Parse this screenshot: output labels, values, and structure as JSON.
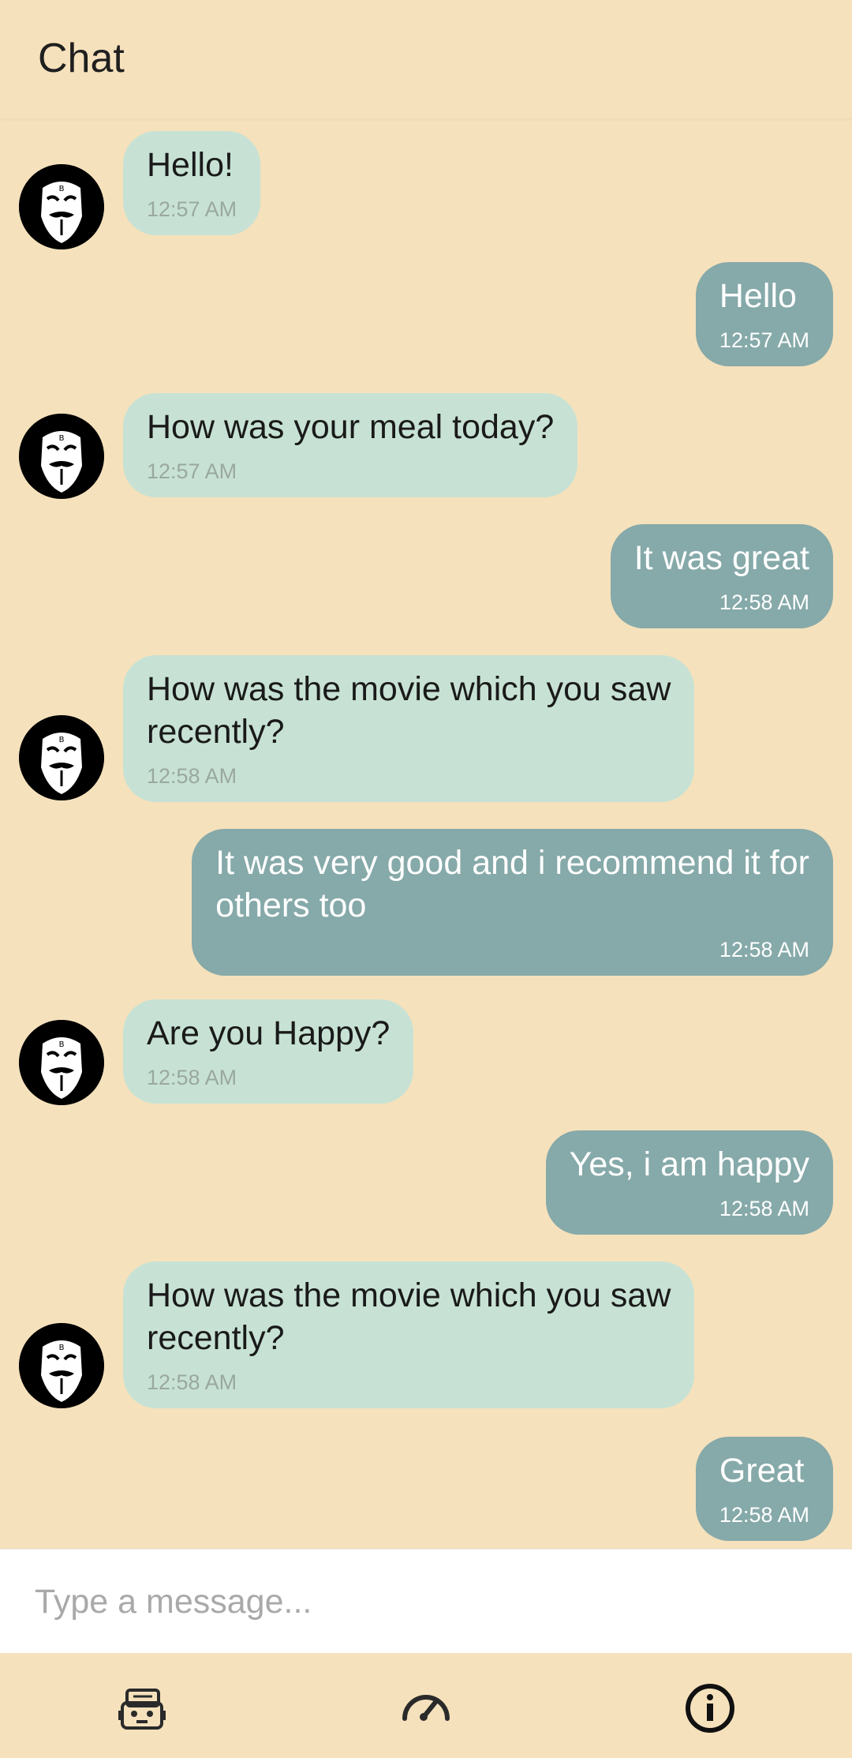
{
  "header": {
    "title": "Chat"
  },
  "messages": [
    {
      "sender": "bot",
      "text": "Hello!",
      "time": "12:57 AM"
    },
    {
      "sender": "user",
      "text": "Hello",
      "time": "12:57 AM"
    },
    {
      "sender": "bot",
      "text": "How was your meal today?",
      "time": "12:57 AM"
    },
    {
      "sender": "user",
      "text": "It was great",
      "time": "12:58 AM"
    },
    {
      "sender": "bot",
      "text": "How was the movie which you saw\nrecently?",
      "time": "12:58 AM"
    },
    {
      "sender": "user",
      "text": "It was very good and i recommend it for\nothers too",
      "time": "12:58 AM"
    },
    {
      "sender": "bot",
      "text": "Are you Happy?",
      "time": "12:58 AM"
    },
    {
      "sender": "user",
      "text": "Yes, i am happy",
      "time": "12:58 AM"
    },
    {
      "sender": "bot",
      "text": "How was the movie which you saw\nrecently?",
      "time": "12:58 AM"
    },
    {
      "sender": "user",
      "text": "Great",
      "time": "12:58 AM"
    }
  ],
  "composer": {
    "placeholder": "Type a message..."
  },
  "nav": {
    "items": [
      {
        "icon": "robot-icon"
      },
      {
        "icon": "speedometer-icon"
      },
      {
        "icon": "info-icon"
      }
    ]
  },
  "colors": {
    "background": "#f5e1bc",
    "bot_bubble": "#c7e2d4",
    "user_bubble": "#86a9a9"
  }
}
